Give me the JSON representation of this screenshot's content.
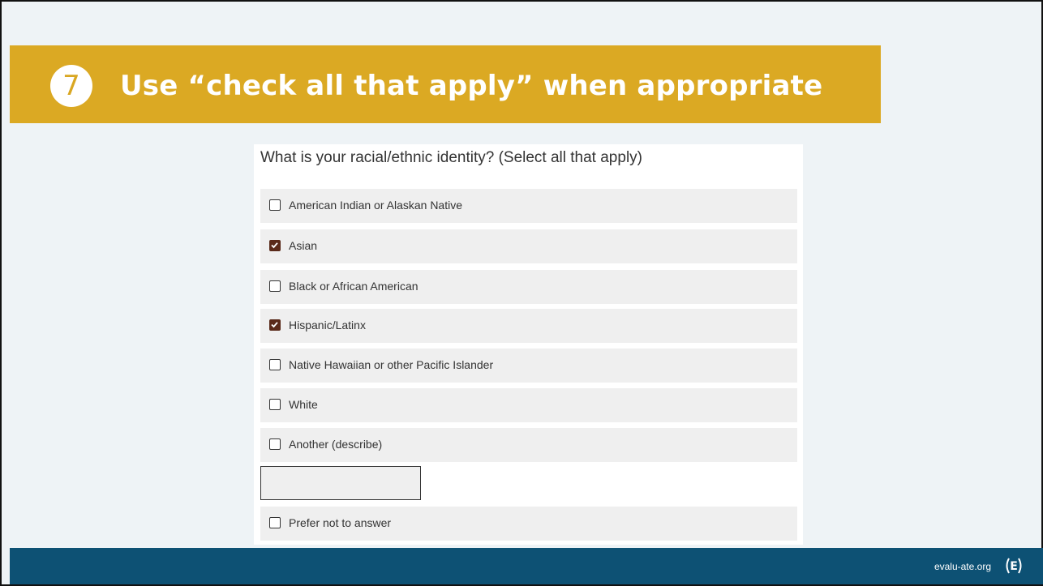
{
  "slide": {
    "number": "7",
    "title": "Use “check all that apply” when appropriate"
  },
  "survey": {
    "question": "What is your racial/ethnic identity? (Select all that apply)",
    "options": [
      {
        "label": "American Indian or Alaskan Native",
        "checked": false
      },
      {
        "label": "Asian",
        "checked": true
      },
      {
        "label": "Black or African American",
        "checked": false
      },
      {
        "label": "Hispanic/Latinx",
        "checked": true
      },
      {
        "label": "Native Hawaiian or other Pacific Islander",
        "checked": false
      },
      {
        "label": "White",
        "checked": false
      },
      {
        "label": "Another (describe)",
        "checked": false
      },
      {
        "label": "Prefer not to answer",
        "checked": false
      }
    ],
    "describe_value": ""
  },
  "footer": {
    "url": "evalu-ate.org",
    "logo_icon": "evalu-ate-logo-icon"
  },
  "colors": {
    "banner": "#dba923",
    "footer": "#0d5174",
    "checked": "#5a2a1a"
  }
}
